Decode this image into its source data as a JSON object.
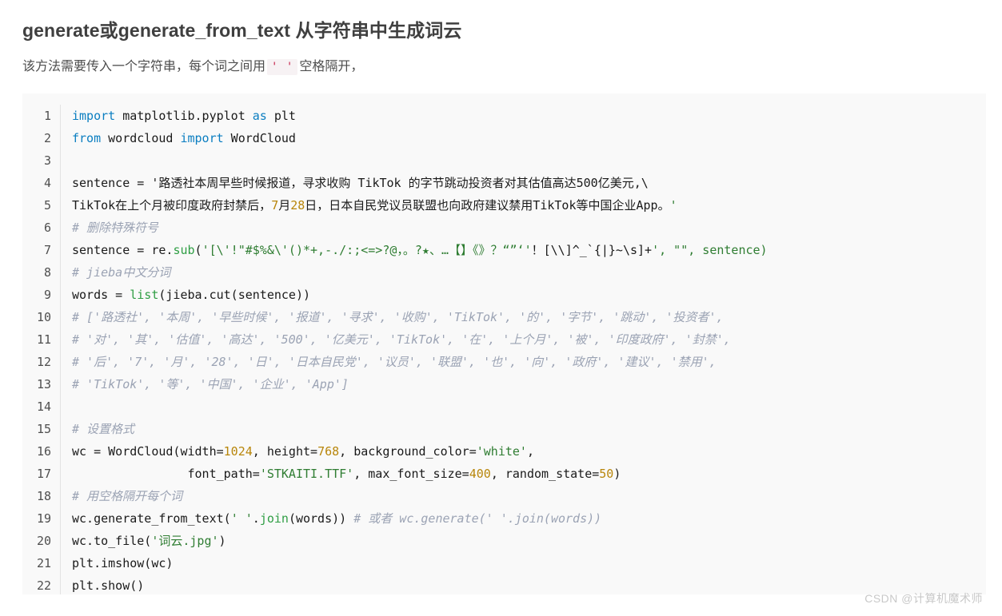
{
  "article": {
    "title": "generate或generate_from_text 从字符串中生成词云",
    "intro_before": "该方法需要传入一个字符串，每个词之间用",
    "intro_code": "' '",
    "intro_after": "空格隔开，"
  },
  "code_block": {
    "language": "python",
    "line_numbers": [
      "1",
      "2",
      "3",
      "4",
      "5",
      "6",
      "7",
      "8",
      "9",
      "10",
      "11",
      "12",
      "13",
      "14",
      "15",
      "16",
      "17",
      "18",
      "19",
      "20",
      "21",
      "22"
    ],
    "lines": [
      "import matplotlib.pyplot as plt",
      "from wordcloud import WordCloud",
      "",
      "sentence = '路透社本周早些时候报道，寻求收购 TikTok 的字节跳动投资者对其估值高达500亿美元,\\",
      "TikTok在上个月被印度政府封禁后，7月28日，日本自民党议员联盟也向政府建议禁用TikTok等中国企业App。'",
      "# 删除特殊符号",
      "sentence = re.sub('[\\'!\"#$%&\\'()*+,-./:;<=>?@，。?★、…【】《》？“”‘'！[\\\\]^_`{|}~\\s]+', \"\", sentence)",
      "# jieba中文分词",
      "words = list(jieba.cut(sentence))",
      "# ['路透社', '本周', '早些时候', '报道', '寻求', '收购', 'TikTok', '的', '字节', '跳动', '投资者',",
      "# '对', '其', '估值', '高达', '500', '亿美元', 'TikTok', '在', '上个月', '被', '印度政府', '封禁',",
      "# '后', '7', '月', '28', '日', '日本自民党', '议员', '联盟', '也', '向', '政府', '建议', '禁用',",
      "# 'TikTok', '等', '中国', '企业', 'App']",
      "",
      "# 设置格式",
      "wc = WordCloud(width=1024, height=768, background_color='white',",
      "                font_path='STKAITI.TTF', max_font_size=400, random_state=50)",
      "# 用空格隔开每个词",
      "wc.generate_from_text(' '.join(words)) # 或者 wc.generate(' '.join(words))",
      "wc.to_file('词云.jpg')",
      "plt.imshow(wc)",
      "plt.show()"
    ]
  },
  "watermark": {
    "text": "CSDN @计算机魔术师"
  },
  "colors": {
    "keyword": "#0b7ec1",
    "function": "#2f9e44",
    "string": "#2f7d32",
    "number": "#b8860b",
    "comment": "#9ba3b4",
    "code_background": "#f9f9f9",
    "title": "#3f3f3f",
    "body_text": "#4d4d4d",
    "inline_code_text": "#c7254e",
    "inline_code_background": "#f7f2f4",
    "watermark": "#c8c8c8"
  }
}
